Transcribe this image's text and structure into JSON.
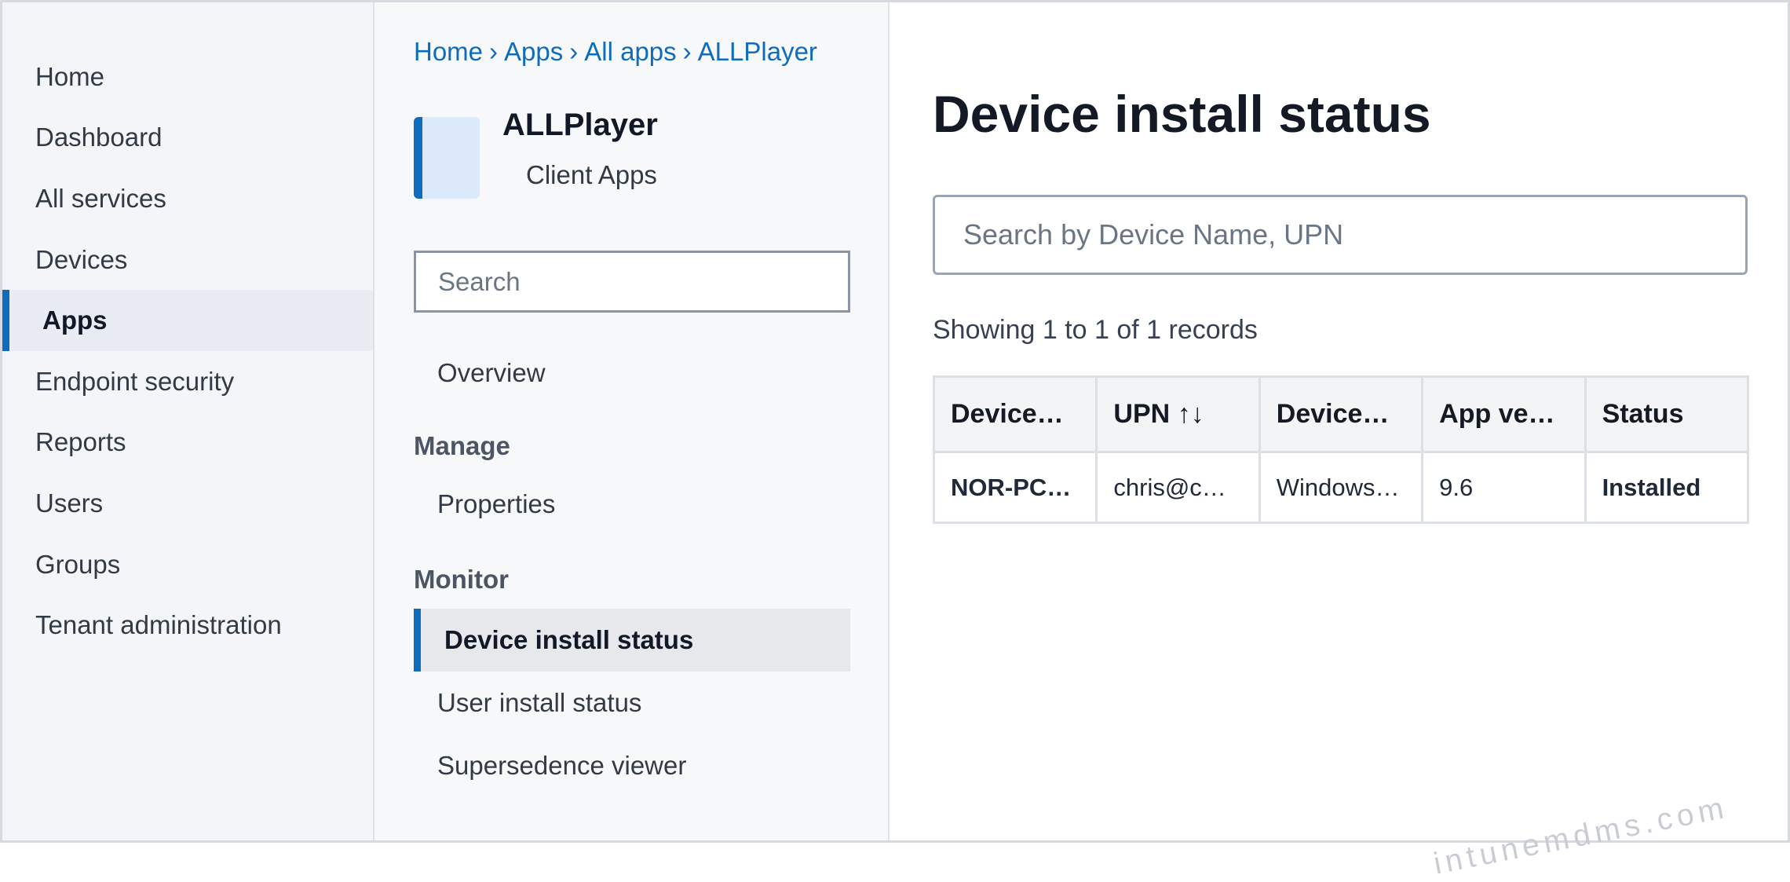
{
  "nav": {
    "items": [
      {
        "label": "Home",
        "active": false
      },
      {
        "label": "Dashboard",
        "active": false
      },
      {
        "label": "All services",
        "active": false
      },
      {
        "label": "Devices",
        "active": false
      },
      {
        "label": "Apps",
        "active": true
      },
      {
        "label": "Endpoint security",
        "active": false
      },
      {
        "label": "Reports",
        "active": false
      },
      {
        "label": "Users",
        "active": false
      },
      {
        "label": "Groups",
        "active": false
      },
      {
        "label": "Tenant administration",
        "active": false
      }
    ]
  },
  "breadcrumb": [
    "Home",
    "Apps",
    "All apps",
    "ALLPlayer"
  ],
  "breadcrumb_sep": "›",
  "app": {
    "name": "ALLPlayer",
    "subtitle": "Client Apps"
  },
  "blade": {
    "search_placeholder": "Search",
    "overview": "Overview",
    "manage_heading": "Manage",
    "properties": "Properties",
    "monitor_heading": "Monitor",
    "device_install_status": "Device install status",
    "user_install_status": "User install status",
    "supersedence_viewer": "Supersedence viewer"
  },
  "main": {
    "title": "Device install status",
    "search_placeholder": "Search by Device Name, UPN",
    "records_text": "Showing 1 to 1 of 1 records",
    "columns": [
      "Device…",
      "UPN ↑↓",
      "Device…",
      "App ve…",
      "Status"
    ],
    "rows": [
      {
        "device_name": "NOR-PC…",
        "upn": "chris@c…",
        "device_os": "Windows…",
        "app_version": "9.6",
        "status": "Installed"
      }
    ]
  },
  "colors": {
    "accent": "#0f6cbd",
    "status_installed": "#107c10"
  },
  "watermark": "intunemdms.com"
}
